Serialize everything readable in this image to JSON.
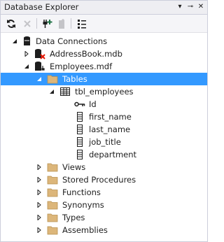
{
  "window": {
    "title": "Database Explorer",
    "menu_glyph": "▾",
    "pin_glyph": "⊸",
    "close_glyph": "✕"
  },
  "toolbar": {
    "buttons": [
      {
        "name": "refresh-button",
        "icon": "refresh-icon",
        "enabled": true
      },
      {
        "name": "delete-button",
        "icon": "delete-icon",
        "enabled": false
      },
      {
        "name": "connect-to-database-button",
        "icon": "connect-icon",
        "enabled": true
      },
      {
        "name": "connect-to-server-button",
        "icon": "server-icon",
        "enabled": false
      },
      {
        "name": "properties-button",
        "icon": "properties-icon",
        "enabled": true
      }
    ]
  },
  "tree": {
    "data_connections": "Data Connections",
    "address_book": "AddressBook.mdb",
    "employees_db": "Employees.mdf",
    "tables": "Tables",
    "tbl_employees": "tbl_employees",
    "columns": [
      "Id",
      "first_name",
      "last_name",
      "job_title",
      "department"
    ],
    "folders": [
      "Views",
      "Stored Procedures",
      "Functions",
      "Synonyms",
      "Types",
      "Assemblies"
    ]
  },
  "colors": {
    "selection": "#3399ff",
    "folder": "#dcb67a",
    "error_badge": "#e51400",
    "toolbar_accent": "#1e7145"
  }
}
